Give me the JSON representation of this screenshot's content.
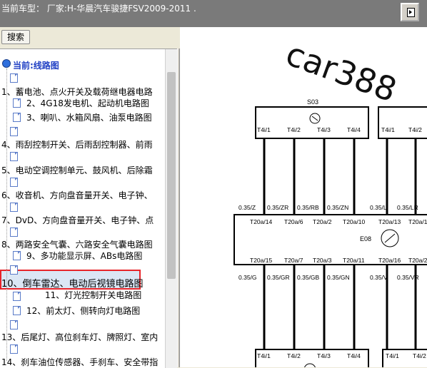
{
  "header": {
    "title": "当前车型： 厂家:H-华晨汽车骏捷FSV2009-2011 ."
  },
  "search": {
    "label": "搜索"
  },
  "tree": {
    "root": "当前:线路图",
    "items": [
      "1、蓄电池、点火开关及载荷继电器电路",
      "2、4G18发电机、起动机电路图",
      "3、喇叭、水箱风扇、油泵电路图",
      "4、雨刮控制开关、后雨刮控制器、前雨",
      "5、电动空调控制单元、鼓风机、后除霜",
      "6、收音机、方向盘音量开关、电子钟、",
      "7、DvD、方向盘音量开关、电子钟、点",
      "8、两路安全气囊、六路安全气囊电路图",
      "9、多功能显示屏、ABs电路图",
      "10、倒车雷达、电动后视镜电路图",
      "11、灯光控制开关电路图",
      "12、前太灯、侧转向灯电路图",
      "13、后尾灯、高位刹车灯、牌照灯、室内",
      "14、刹车油位传感器、手刹车、安全带指"
    ]
  },
  "diagram": {
    "watermark": "car388",
    "top_connector": "S03",
    "top_pins": [
      "T4i/1",
      "T4i/2",
      "T4i/3",
      "T4i/4"
    ],
    "top_right_pins": [
      "T4i/1",
      "T4i/2"
    ],
    "upper_wires": [
      "0.35/Z",
      "0.35/ZR",
      "0.35/RB",
      "0.35/ZN",
      "0.35/L",
      "0.35/LR"
    ],
    "module_name": "E08",
    "module_top_pins": [
      "T20a/14",
      "T20a/6",
      "T20a/2",
      "T20a/10",
      "T20a/13",
      "T20a/1"
    ],
    "module_bottom_pins": [
      "T20a/15",
      "T20a/7",
      "T20a/3",
      "T20a/11",
      "T20a/16",
      "T20a/2"
    ],
    "lower_wires": [
      "0.35/G",
      "0.35/GR",
      "0.35/GB",
      "0.35/GN",
      "0.35/V",
      "0.35/VR"
    ],
    "bottom_pins": [
      "T4i/1",
      "T4i/2",
      "T4i/3",
      "T4i/4"
    ],
    "bottom_right_pins": [
      "T4i/1",
      "T4i/2"
    ]
  }
}
